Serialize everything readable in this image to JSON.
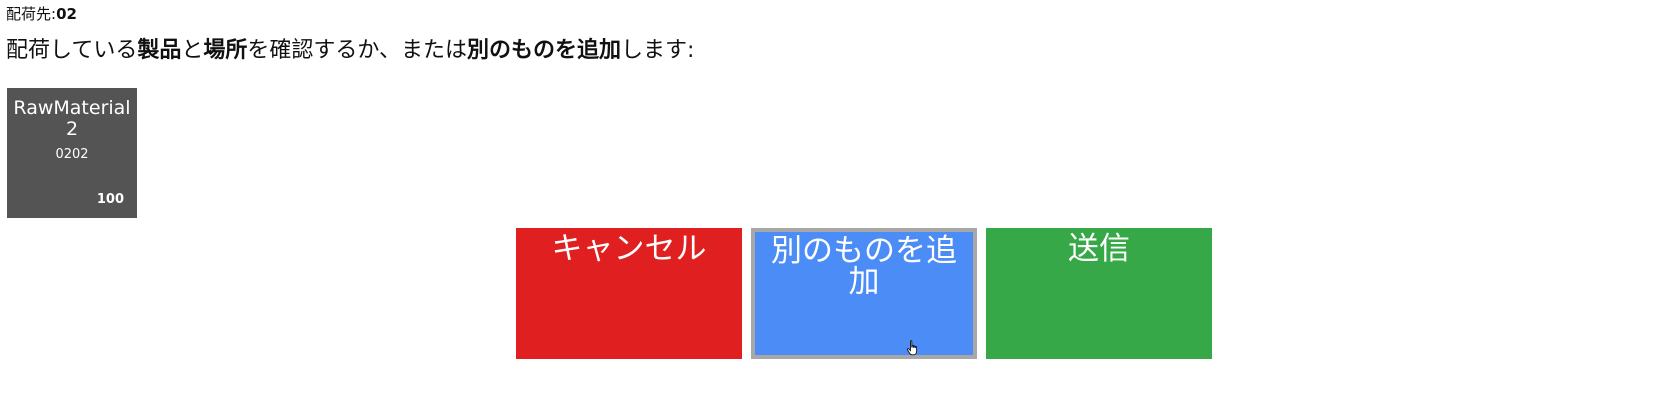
{
  "header": {
    "destination_label": "配荷先:",
    "destination_value": "02"
  },
  "instruction": {
    "part1": "配荷している",
    "bold1": "製品",
    "part2": "と",
    "bold2": "場所",
    "part3": "を確認するか、または",
    "bold3": "別のものを追加",
    "part4": "します:"
  },
  "items": [
    {
      "name": "RawMaterial2",
      "code": "0202",
      "quantity": "100"
    }
  ],
  "actions": {
    "cancel_label": "キャンセル",
    "add_another_label": "別のものを追加",
    "submit_label": "送信"
  },
  "colors": {
    "tile": "#545454",
    "cancel": "#e02020",
    "add_another": "#4b8cf7",
    "submit": "#37a847"
  },
  "icons": {
    "cursor": "hand-pointer-icon"
  }
}
